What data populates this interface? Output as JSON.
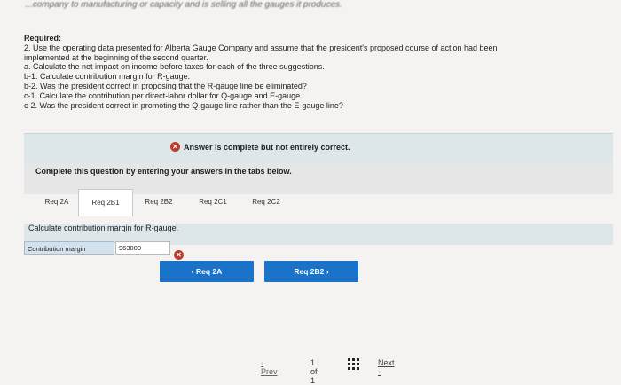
{
  "cut_off_line": "...company to manufacturing or capacity and is selling all the gauges it produces.",
  "required": {
    "title": "Required:",
    "line1": "2. Use the operating data presented for Alberta Gauge Company and assume that the president's proposed course of action had been",
    "line2": "implemented at the beginning of the second quarter.",
    "line3": "a. Calculate the net impact on income before taxes for each of the three suggestions.",
    "line4": "b-1. Calculate contribution margin for R-gauge.",
    "line5": "b-2. Was the president correct in proposing that the R-gauge line be eliminated?",
    "line6": "c-1. Calculate the contribution per direct-labor dollar for Q-gauge and E-gauge.",
    "line7": "c-2. Was the president correct in promoting the Q-gauge line rather than the E-gauge line?"
  },
  "answer_status": "Answer is complete but not entirely correct.",
  "instruction": "Complete this question by entering your answers in the tabs below.",
  "tabs": [
    {
      "label": "Req 2A"
    },
    {
      "label": "Req 2B1"
    },
    {
      "label": "Req 2B2"
    },
    {
      "label": "Req 2C1"
    },
    {
      "label": "Req 2C2"
    }
  ],
  "calc_prompt": "Calculate contribution margin for R-gauge.",
  "row": {
    "label": "Contribution margin",
    "value": "963000"
  },
  "buttons": {
    "prev_tab": "Req 2A",
    "next_tab": "Req 2B2"
  },
  "footer": {
    "prev": "Prev",
    "page": "1 of 1",
    "next": "Next"
  },
  "colors": {
    "accent": "#1a73c8",
    "error": "#c0392b",
    "banner": "#dde7ea"
  }
}
